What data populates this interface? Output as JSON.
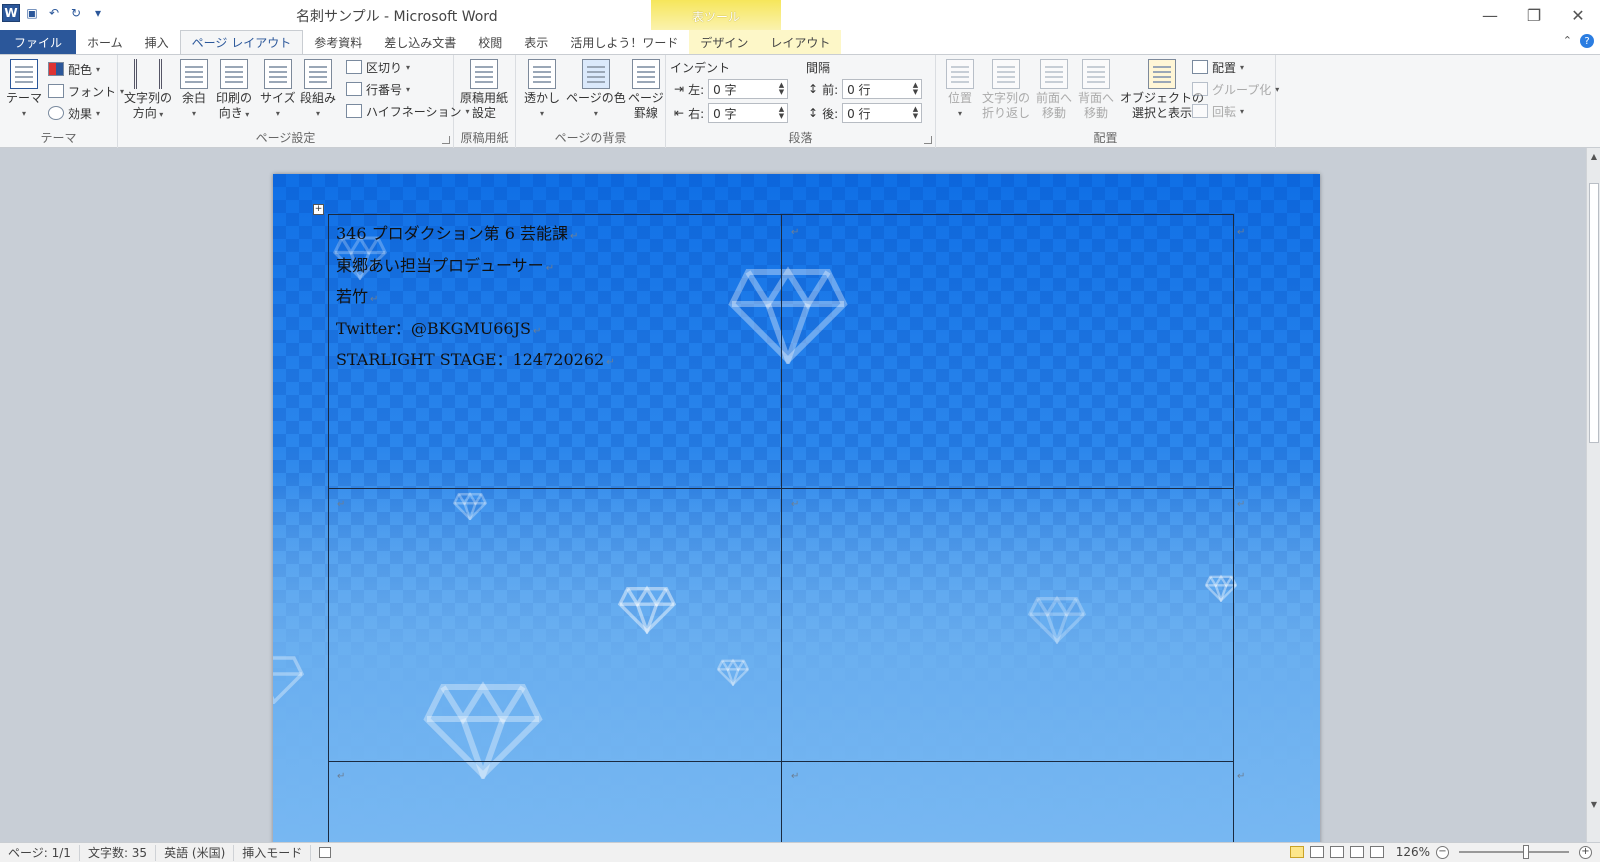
{
  "window": {
    "title": "名刺サンプル - Microsoft Word",
    "contextual_header": "表ツール"
  },
  "tabs": [
    "ファイル",
    "ホーム",
    "挿入",
    "ページ レイアウト",
    "参考資料",
    "差し込み文書",
    "校閲",
    "表示",
    "活用しよう！ワード",
    "デザイン",
    "レイアウト"
  ],
  "ribbon": {
    "theme": {
      "theme_btn": "テーマ",
      "colors": "配色",
      "fonts": "フォント",
      "effects": "効果",
      "label": "テーマ"
    },
    "page_setup": {
      "text_direction": [
        "文字列の",
        "方向"
      ],
      "margins": "余白",
      "orientation": [
        "印刷の",
        "向き"
      ],
      "size": "サイズ",
      "columns": "段組み",
      "breaks": "区切り",
      "line_numbers": "行番号",
      "hyphenation": "ハイフネーション",
      "label": "ページ設定"
    },
    "genko": {
      "btn": [
        "原稿用紙",
        "設定"
      ],
      "label": "原稿用紙"
    },
    "background": {
      "watermark": "透かし",
      "page_color": "ページの色",
      "borders": [
        "ページ",
        "罫線"
      ],
      "label": "ページの背景"
    },
    "paragraph": {
      "indent_head": "インデント",
      "spacing_head": "間隔",
      "left_label": "左:",
      "left_value": "0 字",
      "right_label": "右:",
      "right_value": "0 字",
      "before_label": "前:",
      "before_value": "0 行",
      "after_label": "後:",
      "after_value": "0 行",
      "label": "段落"
    },
    "arrange": {
      "position": "位置",
      "wrap": [
        "文字列の",
        "折り返し"
      ],
      "bring_forward": [
        "前面へ",
        "移動"
      ],
      "send_backward": [
        "背面へ",
        "移動"
      ],
      "selection_pane": [
        "オブジェクトの",
        "選択と表示"
      ],
      "align": "配置",
      "group": "グループ化",
      "rotate": "回転",
      "label": "配置"
    }
  },
  "document": {
    "lines": [
      "346 プロダクション第 6 芸能課",
      "東郷あい担当プロデューサー",
      "若竹",
      "Twitter：@BKGMU66JS",
      "STARLIGHT STAGE：124720262"
    ],
    "cell_mark": "↵"
  },
  "statusbar": {
    "page": "ページ: 1/1",
    "words": "文字数: 35",
    "language": "英語 (米国)",
    "mode": "挿入モード",
    "zoom": "126%"
  },
  "colors": {
    "accent": "#2b579a",
    "page_top": "#0f6fe6",
    "page_bottom": "#7bbaf2",
    "contextual": "#f6e65b"
  }
}
